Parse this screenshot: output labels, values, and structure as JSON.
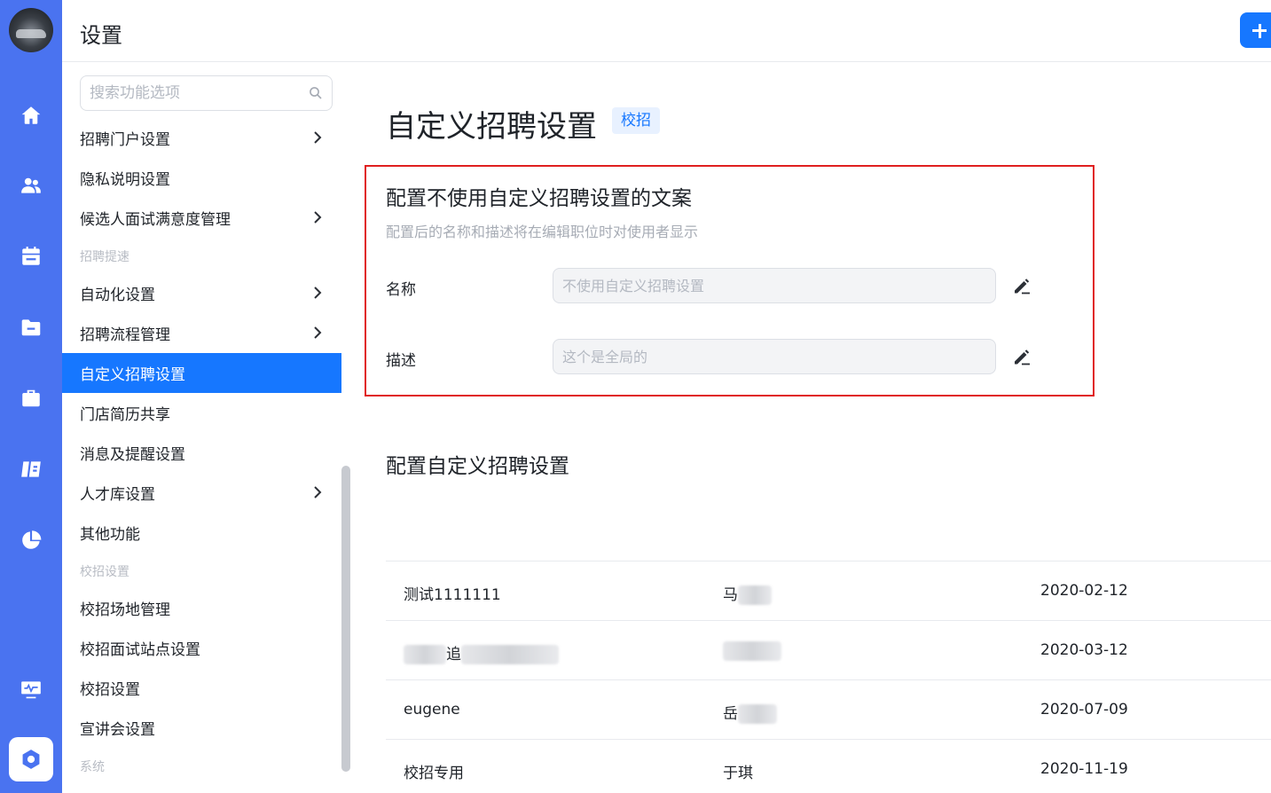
{
  "header": {
    "title": "设置",
    "add_icon": "plus-icon"
  },
  "rail": {
    "icons": [
      "home-icon",
      "users-icon",
      "calendar-icon",
      "folder-icon",
      "briefcase-icon",
      "book-icon",
      "pie-chart-icon",
      "monitor-icon",
      "settings-icon"
    ],
    "accent_color": "#4a73f0"
  },
  "menu": {
    "search_placeholder": "搜索功能选项",
    "items": [
      {
        "label": "招聘门户设置",
        "chevron": true
      },
      {
        "label": "隐私说明设置",
        "chevron": false
      },
      {
        "label": "候选人面试满意度管理",
        "chevron": true
      },
      {
        "group": "招聘提速"
      },
      {
        "label": "自动化设置",
        "chevron": true
      },
      {
        "label": "招聘流程管理",
        "chevron": true
      },
      {
        "label": "自定义招聘设置",
        "chevron": false,
        "active": true
      },
      {
        "label": "门店简历共享",
        "chevron": false
      },
      {
        "label": "消息及提醒设置",
        "chevron": false
      },
      {
        "label": "人才库设置",
        "chevron": true
      },
      {
        "label": "其他功能",
        "chevron": false
      },
      {
        "group": "校招设置"
      },
      {
        "label": "校招场地管理",
        "chevron": false
      },
      {
        "label": "校招面试站点设置",
        "chevron": false
      },
      {
        "label": "校招设置",
        "chevron": false
      },
      {
        "label": "宣讲会设置",
        "chevron": false
      },
      {
        "group": "系统"
      }
    ],
    "active_color": "#1677ff"
  },
  "main": {
    "title": "自定义招聘设置",
    "tag": "校招",
    "section1": {
      "title": "配置不使用自定义招聘设置的文案",
      "desc": "配置后的名称和描述将在编辑职位时对使用者显示",
      "name_label": "名称",
      "name_placeholder": "不使用自定义招聘设置",
      "desc_label": "描述",
      "desc_placeholder": "这个是全局的"
    },
    "section2": {
      "title": "配置自定义招聘设置"
    },
    "rows": [
      {
        "name": "测试1111111",
        "owner": "马",
        "date": "2020-02-12"
      },
      {
        "name": "追",
        "owner": "",
        "date": "2020-03-12"
      },
      {
        "name": "eugene",
        "owner": "岳",
        "date": "2020-07-09"
      },
      {
        "name": "校招专用",
        "owner": "于琪",
        "date": "2020-11-19"
      }
    ]
  }
}
